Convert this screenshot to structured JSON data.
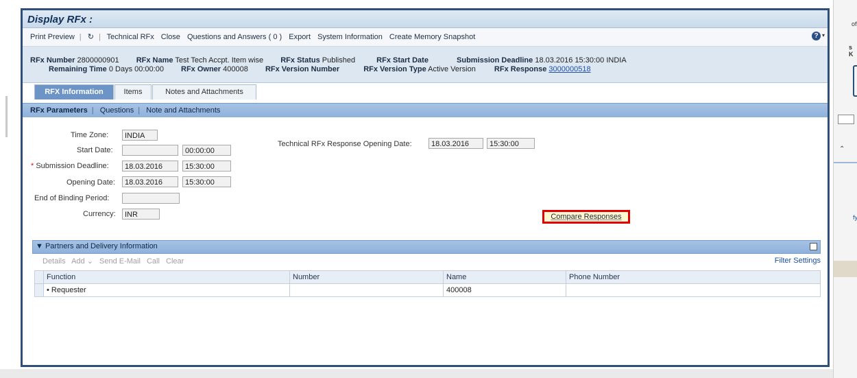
{
  "window": {
    "title": "Display RFx :"
  },
  "toolbar": {
    "print_preview": "Print Preview",
    "refresh_glyph": "↻",
    "technical_rfx": "Technical RFx",
    "close": "Close",
    "qna": "Questions and Answers ( 0 )",
    "export": "Export",
    "system_info": "System Information",
    "memory_snapshot": "Create Memory Snapshot",
    "help_glyph": "?"
  },
  "header": {
    "rfx_number_label": "RFx Number",
    "rfx_number": "2800000901",
    "rfx_name_label": "RFx Name",
    "rfx_name": "Test Tech Accpt. Item wise",
    "rfx_status_label": "RFx Status",
    "rfx_status": "Published",
    "rfx_start_label": "RFx Start Date",
    "submission_label": "Submission Deadline",
    "submission": "18.03.2016 15:30:00 INDIA",
    "remaining_label": "Remaining Time",
    "remaining": "0 Days 00:00:00",
    "owner_label": "RFx Owner",
    "owner": "400008",
    "version_number_label": "RFx Version Number",
    "version_type_label": "RFx Version Type",
    "version_type": "Active Version",
    "response_label": "RFx Response",
    "response": "3000000518"
  },
  "tabs": [
    "RFX Information",
    "Items",
    "Notes and Attachments"
  ],
  "subtabs": [
    "RFx Parameters",
    "Questions",
    "Note and Attachments"
  ],
  "form": {
    "time_zone_label": "Time Zone:",
    "time_zone": "INDIA",
    "start_date_label": "Start Date:",
    "start_time": "00:00:00",
    "submission_label": "Submission Deadline:",
    "submission_date": "18.03.2016",
    "submission_time": "15:30:00",
    "opening_label": "Opening Date:",
    "opening_date": "18.03.2016",
    "opening_time": "15:30:00",
    "binding_label": "End of Binding Period:",
    "currency_label": "Currency:",
    "currency": "INR",
    "tech_opening_label": "Technical RFx Response Opening Date:",
    "tech_opening_date": "18.03.2016",
    "tech_opening_time": "15:30:00",
    "compare_button": "Compare Responses"
  },
  "partners": {
    "title": "Partners and Delivery Information",
    "toolbar": [
      "Details",
      "Add ⌄",
      "Send E-Mail",
      "Call",
      "Clear"
    ],
    "filter": "Filter Settings",
    "columns": [
      "Function",
      "Number",
      "Name",
      "Phone Number"
    ],
    "rows": [
      {
        "function": "Requester",
        "number": "",
        "name": "400008",
        "phone": ""
      }
    ]
  },
  "background": {
    "right_1": "off",
    "right_2": "s K",
    "right_3": "fy"
  }
}
